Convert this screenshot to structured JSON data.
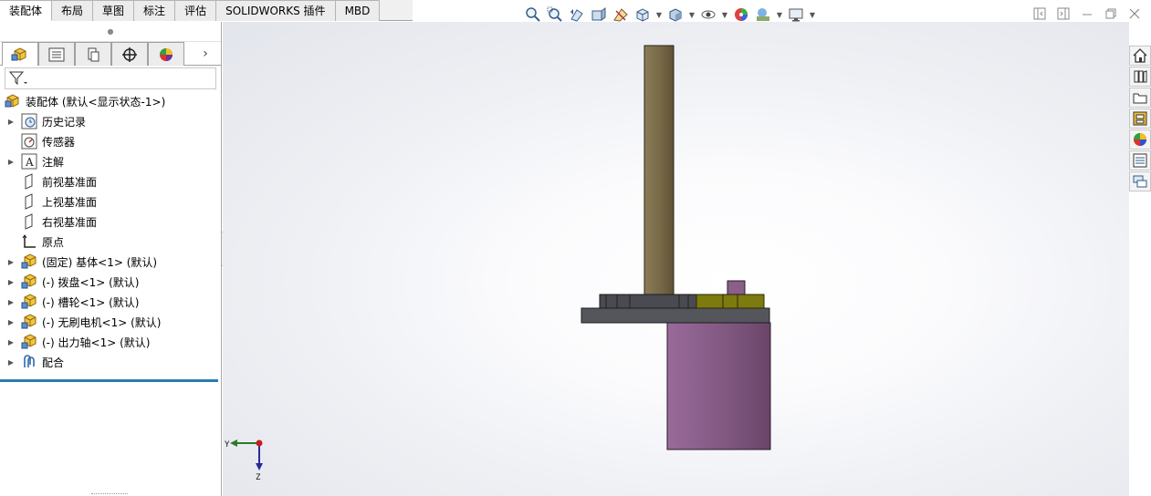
{
  "tabs": [
    {
      "label": "装配体",
      "active": true
    },
    {
      "label": "布局",
      "active": false
    },
    {
      "label": "草图",
      "active": false
    },
    {
      "label": "标注",
      "active": false
    },
    {
      "label": "评估",
      "active": false
    },
    {
      "label": "SOLIDWORKS 插件",
      "active": false
    },
    {
      "label": "MBD",
      "active": false
    }
  ],
  "view_toolbar_icons": [
    "zoom-to-fit-icon",
    "zoom-to-area-icon",
    "previous-view-icon",
    "section-view-icon",
    "dynamic-annotation-icon",
    "view-orientation-icon",
    "display-style-icon",
    "hide-show-items-icon",
    "edit-appearance-icon",
    "apply-scene-icon",
    "view-settings-icon"
  ],
  "feature_manager": {
    "root": {
      "label": "装配体  (默认<显示状态-1>)",
      "icon": "assembly-icon"
    },
    "items": [
      {
        "label": "历史记录",
        "icon": "history-icon",
        "expandable": true
      },
      {
        "label": "传感器",
        "icon": "sensor-icon",
        "expandable": false
      },
      {
        "label": "注解",
        "icon": "annotation-icon",
        "expandable": true
      },
      {
        "label": "前视基准面",
        "icon": "plane-icon",
        "expandable": false
      },
      {
        "label": "上视基准面",
        "icon": "plane-icon",
        "expandable": false
      },
      {
        "label": "右视基准面",
        "icon": "plane-icon",
        "expandable": false
      },
      {
        "label": "原点",
        "icon": "origin-icon",
        "expandable": false
      },
      {
        "label": "(固定) 基体<1> (默认)",
        "icon": "part-icon",
        "expandable": true
      },
      {
        "label": "(-) 拨盘<1> (默认)",
        "icon": "part-icon",
        "expandable": true
      },
      {
        "label": "(-) 槽轮<1> (默认)",
        "icon": "part-icon",
        "expandable": true
      },
      {
        "label": "(-) 无刷电机<1> (默认)",
        "icon": "part-icon",
        "expandable": true
      },
      {
        "label": "(-) 出力轴<1> (默认)",
        "icon": "part-icon",
        "expandable": true
      },
      {
        "label": "配合",
        "icon": "mates-icon",
        "expandable": true
      }
    ]
  },
  "triad": {
    "y_label": "Y",
    "z_label": "Z"
  },
  "task_pane_icons": [
    "home-icon",
    "design-library-icon",
    "file-explorer-icon",
    "view-palette-icon",
    "appearances-icon",
    "custom-properties-icon",
    "forum-icon"
  ],
  "colors": {
    "shaft": "#7a6b4c",
    "motor": "#8a5f8a",
    "base_plate": "#55565c",
    "dial": "#4a4a52",
    "geneva": "#7d7a10",
    "pin": "#8a5f8a"
  }
}
